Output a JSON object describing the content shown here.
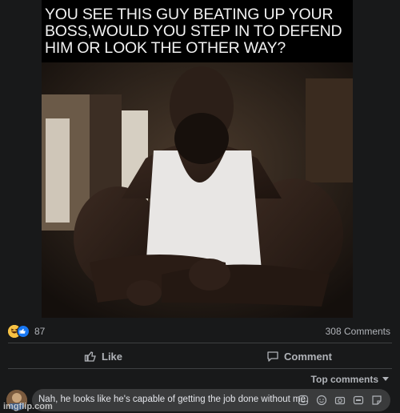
{
  "post": {
    "caption_lines": [
      "YOU SEE THIS GUY BEATING UP YOUR",
      "BOSS,WOULD YOU STEP IN TO DEFEND",
      "HIM OR LOOK THE OTHER WAY?"
    ]
  },
  "reactions": {
    "count": "87",
    "comments": "308 Comments",
    "icons": [
      "haha-reaction-icon",
      "like-reaction-icon"
    ]
  },
  "actions": {
    "like_label": "Like",
    "comment_label": "Comment"
  },
  "sort": {
    "label": "Top comments"
  },
  "comment": {
    "text": "Nah, he looks like he's capable of getting the job done without me.",
    "tools": [
      "sticker-icon",
      "emoji-icon",
      "camera-icon",
      "gif-icon",
      "sticker-alt-icon"
    ]
  },
  "watermark": "imgflip.com",
  "colors": {
    "background": "#18191a",
    "comment_box": "#3a3b3c",
    "text_secondary": "#b0b3b8",
    "like_blue": "#1877f2"
  }
}
